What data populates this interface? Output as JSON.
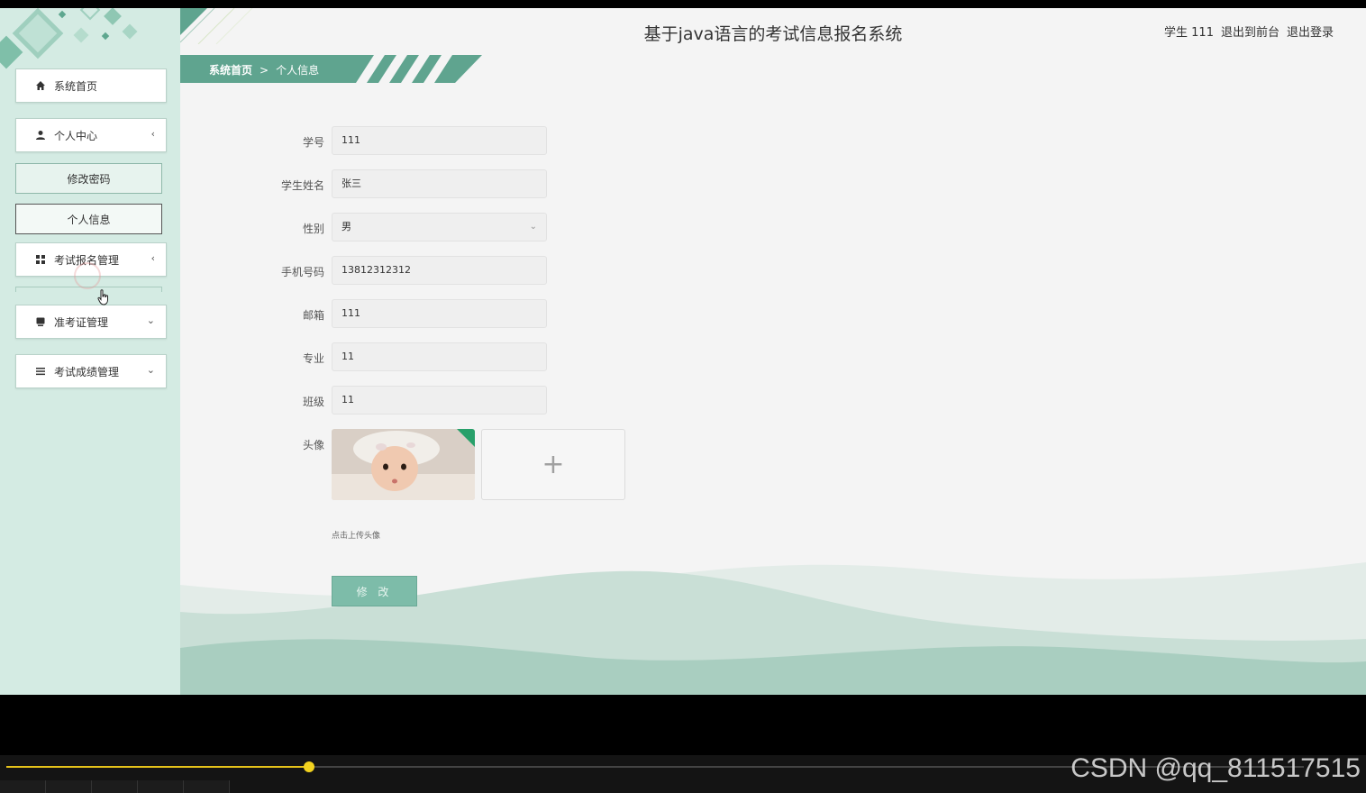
{
  "header": {
    "title": "基于java语言的考试信息报名系统",
    "user_label": "学生 111",
    "to_front_label": "退出到前台",
    "logout_label": "退出登录"
  },
  "breadcrumb": {
    "home": "系统首页",
    "separator": ">",
    "current": "个人信息"
  },
  "sidebar": {
    "items": [
      {
        "label": "系统首页",
        "icon": "home-icon"
      },
      {
        "label": "个人中心",
        "icon": "user-icon"
      },
      {
        "label": "修改密码"
      },
      {
        "label": "个人信息"
      },
      {
        "label": "考试报名管理",
        "icon": "grid-icon"
      },
      {
        "label": "准考证管理",
        "icon": "card-icon"
      },
      {
        "label": "考试成绩管理",
        "icon": "list-icon"
      }
    ]
  },
  "form": {
    "student_id": {
      "label": "学号",
      "value": "111"
    },
    "name": {
      "label": "学生姓名",
      "value": "张三"
    },
    "gender": {
      "label": "性别",
      "value": "男"
    },
    "phone": {
      "label": "手机号码",
      "value": "13812312312"
    },
    "email": {
      "label": "邮箱",
      "value": "111"
    },
    "major": {
      "label": "专业",
      "value": "11"
    },
    "class": {
      "label": "班级",
      "value": "11"
    },
    "avatar": {
      "label": "头像",
      "upload_icon": "+",
      "tip": "点击上传头像"
    },
    "submit_label": "修 改"
  },
  "player": {
    "progress": 0.233
  },
  "watermark": "CSDN @qq_811517515",
  "colors": {
    "accent": "#7dbca9",
    "sidebar_bg": "#d4ebe3",
    "breadcrumb_bg": "#5fa48f"
  }
}
